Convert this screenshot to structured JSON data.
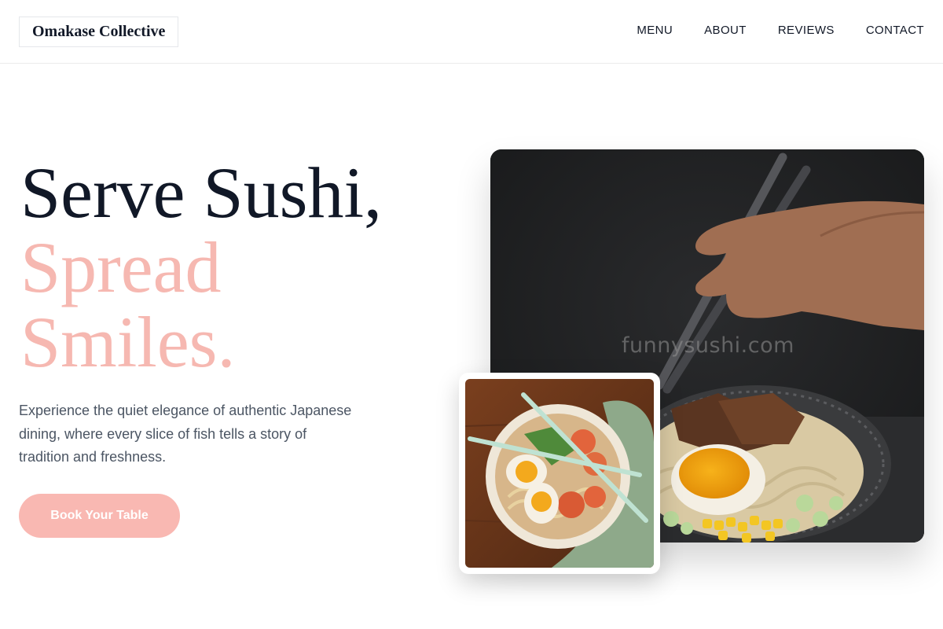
{
  "brand": {
    "name": "Omakase Collective"
  },
  "nav": {
    "items": [
      "MENU",
      "ABOUT",
      "REVIEWS",
      "CONTACT"
    ]
  },
  "hero": {
    "title_line1": "Serve Sushi,",
    "title_line2": "Spread",
    "title_line3": "Smiles.",
    "description": "Experience the quiet elegance of authentic Japanese dining, where every slice of fish tells a story of tradition and freshness.",
    "cta_label": "Book Your Table"
  },
  "images": {
    "main": {
      "icon": "ramen-bowl-with-chopsticks-photo",
      "watermark": "funnysushi.com"
    },
    "secondary": {
      "icon": "ramen-bowl-top-view-photo"
    }
  },
  "colors": {
    "accent": "#f9b8b2",
    "title_dark": "#111827",
    "title_pink": "#f6b8b1",
    "body_text": "#4b5563"
  }
}
